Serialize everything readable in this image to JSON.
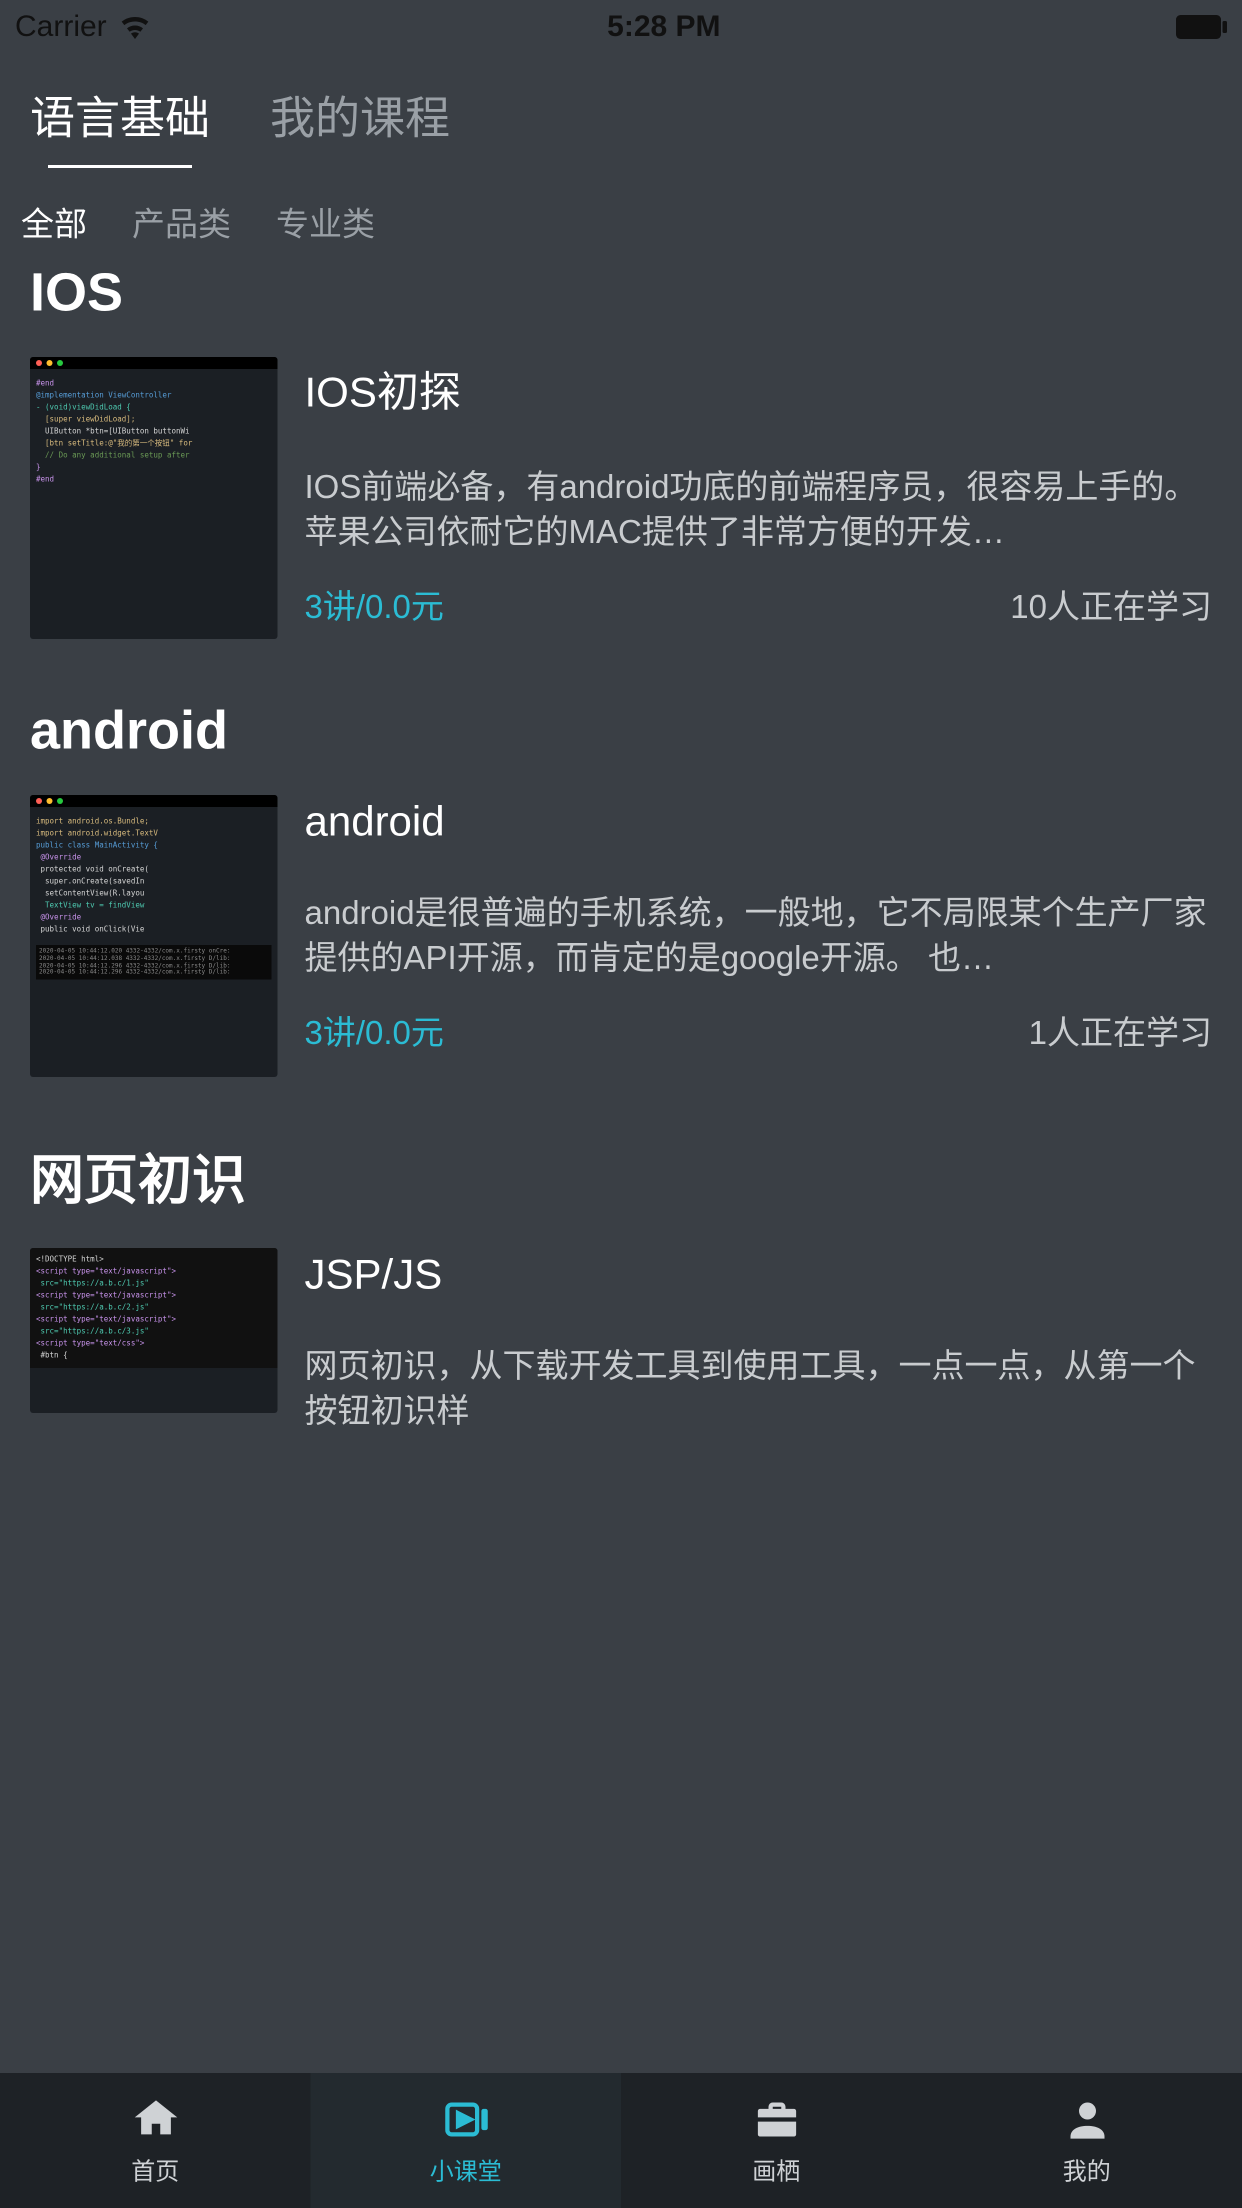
{
  "status": {
    "carrier": "Carrier",
    "time": "5:28 PM"
  },
  "topTabs": [
    {
      "label": "语言基础",
      "active": true
    },
    {
      "label": "我的课程",
      "active": false
    }
  ],
  "filterTabs": [
    {
      "label": "全部",
      "active": true
    },
    {
      "label": "产品类",
      "active": false
    },
    {
      "label": "专业类",
      "active": false
    }
  ],
  "sections": [
    {
      "heading": "IOS",
      "course": {
        "title": "IOS初探",
        "desc": "IOS前端必备，有android功底的前端程序员，很容易上手的。苹果公司依耐它的MAC提供了非常方便的开发…",
        "price": "3讲/0.0元",
        "learners": "10人正在学习"
      }
    },
    {
      "heading": "android",
      "course": {
        "title": "android",
        "desc": "android是很普遍的手机系统，一般地，它不局限某个生产厂家提供的API开源，而肯定的是google开源。 也…",
        "price": "3讲/0.0元",
        "learners": "1人正在学习"
      }
    },
    {
      "heading": "网页初识",
      "course": {
        "title": "JSP/JS",
        "desc": "网页初识，从下载开发工具到使用工具，一点一点，从第一个按钮初识样",
        "price": "",
        "learners": ""
      }
    }
  ],
  "tabs": [
    {
      "label": "首页"
    },
    {
      "label": "小课堂"
    },
    {
      "label": "画栖"
    },
    {
      "label": "我的"
    }
  ]
}
